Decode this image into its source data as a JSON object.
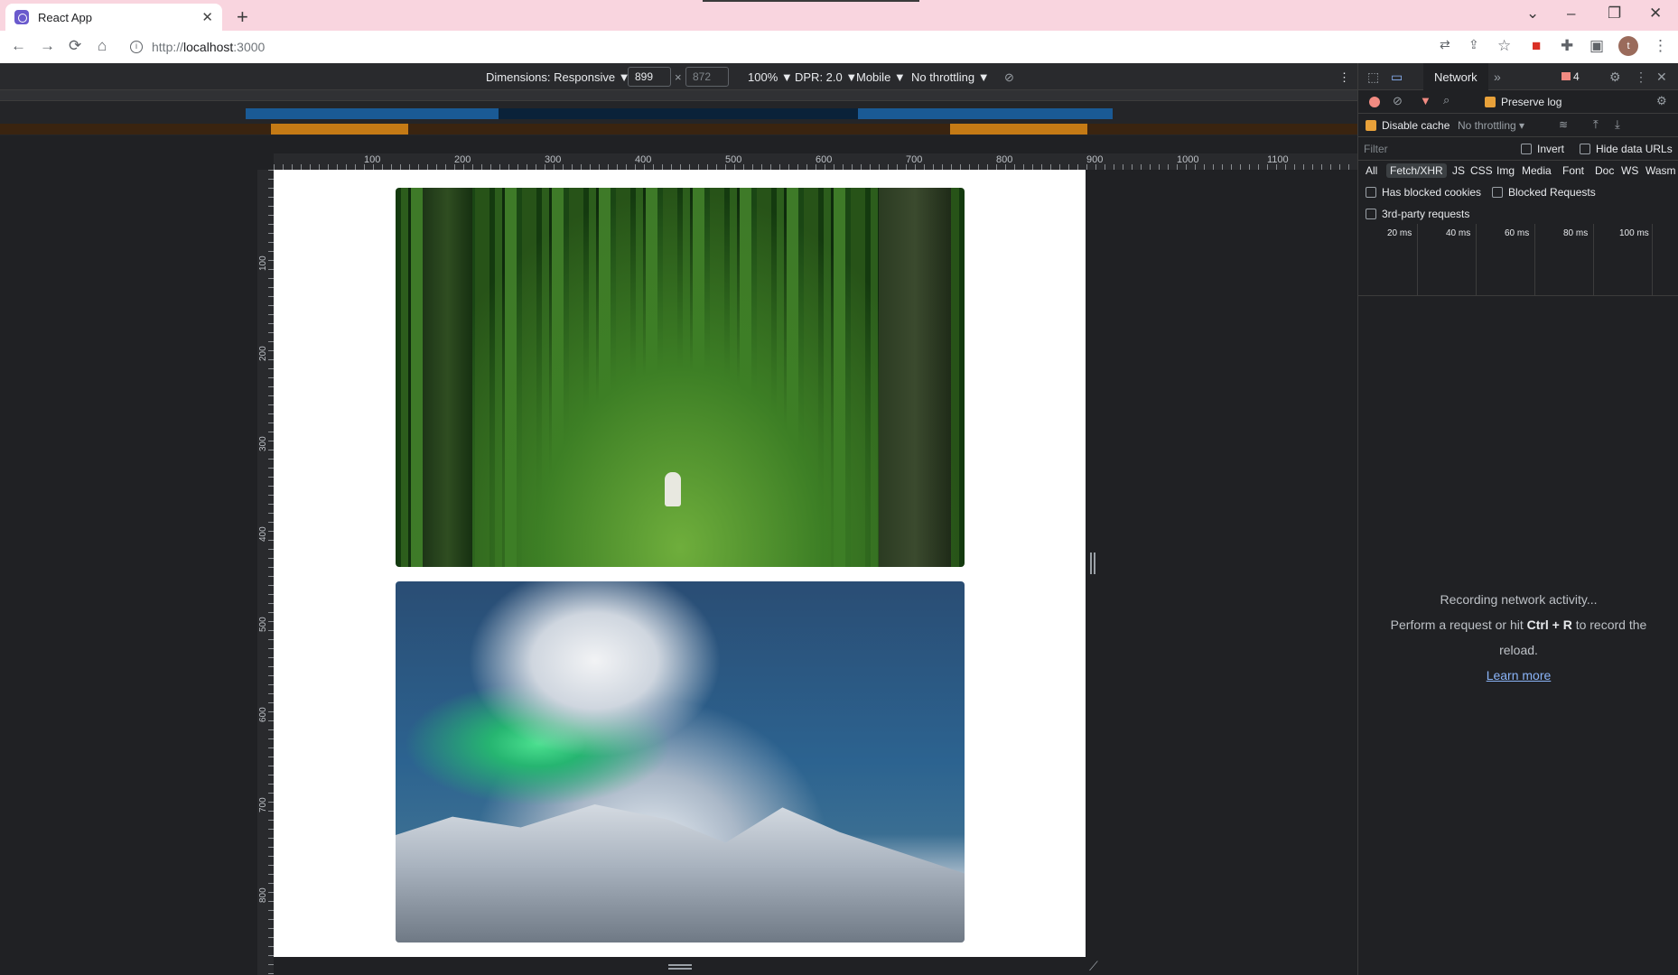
{
  "tab": {
    "title": "React App",
    "close": "✕"
  },
  "new_tab": "+",
  "window": {
    "minimize": "–",
    "restore": "❐",
    "close": "✕",
    "dropdown": "⌄"
  },
  "toolbar": {
    "back": "←",
    "forward": "→",
    "reload": "⟳",
    "home": "⌂",
    "url_scheme": "http://",
    "url_host": "localhost",
    "url_port": ":3000",
    "profile_initial": "t"
  },
  "device_toolbar": {
    "dimensions": "Dimensions: Responsive ▼",
    "width": "899",
    "x": "×",
    "height": "872",
    "zoom": "100% ▼",
    "dpr": "DPR: 2.0 ▼",
    "mode": "Mobile ▼",
    "throttle": "No throttling ▼",
    "more": "⋮"
  },
  "rulers": {
    "top": [
      "100",
      "200",
      "300",
      "400",
      "500",
      "600",
      "700",
      "800",
      "900",
      "1000",
      "1100"
    ],
    "left": [
      "100",
      "200",
      "300",
      "400",
      "500",
      "600",
      "700",
      "800"
    ]
  },
  "devtools": {
    "tab_network": "Network",
    "more_tabs": "»",
    "error_count": "4",
    "preserve_log": "Preserve log",
    "disable_cache": "Disable cache",
    "throttling": "No throttling",
    "filter_placeholder": "Filter",
    "invert": "Invert",
    "hide_data_urls": "Hide data URLs",
    "filter_types": [
      "All",
      "Fetch/XHR",
      "JS",
      "CSS",
      "Img",
      "Media",
      "Font",
      "Doc",
      "WS",
      "Wasm"
    ],
    "has_blocked_cookies": "Has blocked cookies",
    "blocked_requests": "Blocked Requests",
    "third_party": "3rd-party requests",
    "timeline_ticks": [
      "20 ms",
      "40 ms",
      "60 ms",
      "80 ms",
      "100 ms"
    ],
    "empty_line1": "Recording network activity...",
    "empty_line2_a": "Perform a request or hit ",
    "empty_line2_b": "Ctrl + R",
    "empty_line2_c": " to record the",
    "empty_line3": "reload.",
    "learn_more": "Learn more"
  },
  "colors": {
    "accent_orange": "#e8a13a",
    "tab_strip": "#f9d5df",
    "link": "#8ab4f8"
  }
}
